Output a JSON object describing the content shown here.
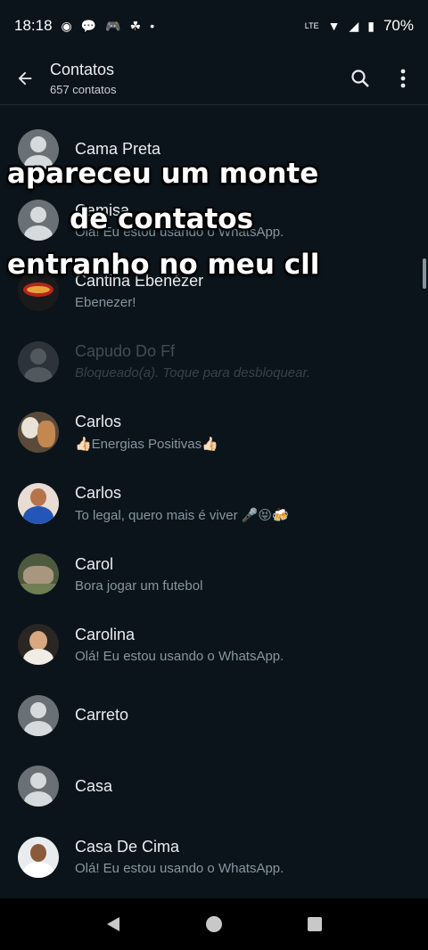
{
  "status": {
    "time": "18:18",
    "network": "LTE",
    "battery": "70%",
    "icons": [
      "status-dot-icon",
      "chat-bubble-icon",
      "game-icon",
      "app-icon",
      "notification-dot-icon",
      "volte-icon",
      "wifi-icon",
      "signal-icon",
      "battery-icon"
    ]
  },
  "header": {
    "title": "Contatos",
    "subtitle": "657 contatos"
  },
  "contacts": [
    {
      "name": "Cama Preta",
      "about": ""
    },
    {
      "name": "Camisa",
      "about": "Olá! Eu estou usando o WhatsApp."
    },
    {
      "name": "Cantina Ebenézer",
      "about": "Ebenezer!"
    },
    {
      "name": "Capudo Do Ff",
      "about": "Bloqueado(a). Toque para desbloquear."
    },
    {
      "name": "Carlos",
      "about": "👍🏻Energias Positivas👍🏻"
    },
    {
      "name": "Carlos",
      "about": "To legal, quero mais é viver 🎤😝🍻"
    },
    {
      "name": "Carol",
      "about": "Bora jogar um futebol"
    },
    {
      "name": "Carolina",
      "about": "Olá! Eu estou usando o WhatsApp."
    },
    {
      "name": "Carreto",
      "about": ""
    },
    {
      "name": "Casa",
      "about": ""
    },
    {
      "name": "Casa De Cima",
      "about": "Olá! Eu estou usando o WhatsApp."
    }
  ],
  "overlay": {
    "line1": "apareceu um monte",
    "line2": "de contatos",
    "line3": "entranho no meu cll"
  },
  "colors": {
    "background": "#0b141a",
    "primary_text": "#e9edef",
    "secondary_text": "#8696a0"
  }
}
